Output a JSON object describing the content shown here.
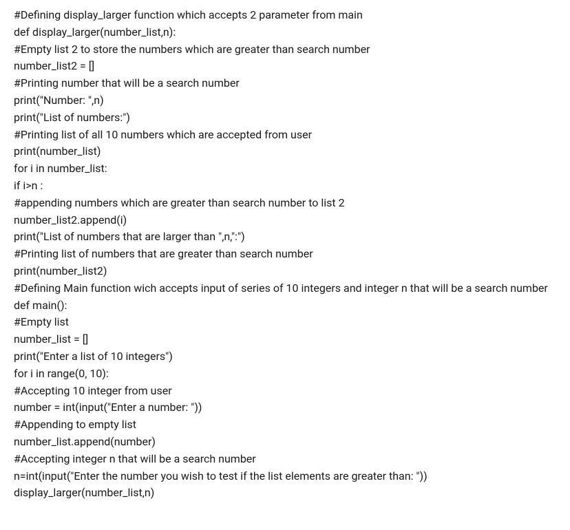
{
  "code": {
    "lines": [
      "#Defining display_larger function which accepts 2 parameter from main",
      "def display_larger(number_list,n):",
      "#Empty list 2 to store the numbers which are greater than search number",
      "number_list2 = []",
      "#Printing number that will be a search number",
      "print(\"Number: \",n)",
      "print(\"List of numbers:\")",
      "#Printing list of all 10 numbers which are accepted from user",
      "print(number_list)",
      "for i in number_list:",
      "if i>n :",
      "#appending numbers which are greater than search number to list 2",
      "number_list2.append(i)",
      "print(\"List of numbers that are larger than \",n,\":\")",
      "#Printing list of numbers that are greater than search number",
      "print(number_list2)",
      "#Defining Main function wich accepts input of series of 10 integers and integer n that will be a search number",
      "def main():",
      "#Empty list",
      "number_list = []",
      "print(\"Enter a list of 10 integers\")",
      "for i in range(0, 10):",
      "#Accepting 10 integer from user",
      "number = int(input(\"Enter a number: \"))",
      "#Appending to empty list",
      "number_list.append(number)",
      "#Accepting integer n that will be a search number",
      "n=int(input(\"Enter the number you wish to test if the list elements are greater than: \"))",
      "display_larger(number_list,n)"
    ]
  }
}
